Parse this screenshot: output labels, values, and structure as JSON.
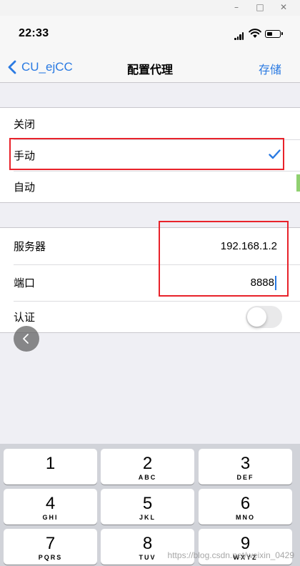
{
  "status_bar": {
    "time": "22:33"
  },
  "nav": {
    "back_label": "CU_ejCC",
    "title": "配置代理",
    "save_label": "存储"
  },
  "proxy_modes": [
    {
      "label": "关闭",
      "selected": false
    },
    {
      "label": "手动",
      "selected": true
    },
    {
      "label": "自动",
      "selected": false
    }
  ],
  "manual_fields": {
    "server_label": "服务器",
    "server_value": "192.168.1.2",
    "port_label": "端口",
    "port_value": "8888",
    "auth_label": "认证",
    "auth_enabled": false
  },
  "keypad": [
    {
      "num": "1",
      "letters": ""
    },
    {
      "num": "2",
      "letters": "ABC"
    },
    {
      "num": "3",
      "letters": "DEF"
    },
    {
      "num": "4",
      "letters": "GHI"
    },
    {
      "num": "5",
      "letters": "JKL"
    },
    {
      "num": "6",
      "letters": "MNO"
    },
    {
      "num": "7",
      "letters": "PQRS"
    },
    {
      "num": "8",
      "letters": "TUV"
    },
    {
      "num": "9",
      "letters": "WXYZ"
    }
  ],
  "watermark": "https://blog.csdn.net/weixin_0429",
  "colors": {
    "accent": "#2a7ae2",
    "highlight": "#e8222a",
    "keypad_bg": "#d1d3d9"
  }
}
